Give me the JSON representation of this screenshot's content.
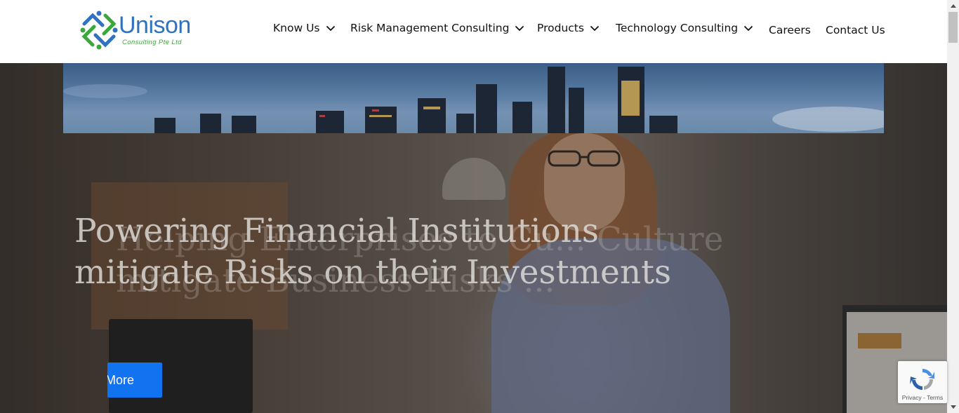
{
  "brand": {
    "name": "Unison",
    "tagline": "Consulting Pte Ltd",
    "colors": {
      "blue": "#2f72c2",
      "green": "#3ba83b"
    }
  },
  "nav": {
    "items": [
      {
        "label": "Know Us",
        "has_dropdown": true
      },
      {
        "label": "Risk Management Consulting",
        "has_dropdown": true
      },
      {
        "label": "Products",
        "has_dropdown": true
      },
      {
        "label": "Technology Consulting",
        "has_dropdown": true
      },
      {
        "label": "Careers",
        "has_dropdown": false
      },
      {
        "label": "Contact Us",
        "has_dropdown": false
      }
    ],
    "dropdown_icon": "chevron-down-icon"
  },
  "hero": {
    "headline_line1": "Powering Financial Institutions",
    "headline_line2": "mitigate Risks on their Investments",
    "ghost_line1": "Helping Enterprises to Cu... Culture",
    "ghost_line2": "mitigate Business Risks ...",
    "cta_label": "More",
    "cta_color": "#1173f0"
  },
  "recaptcha": {
    "links": "Privacy - Terms",
    "icon": "recaptcha-icon"
  }
}
